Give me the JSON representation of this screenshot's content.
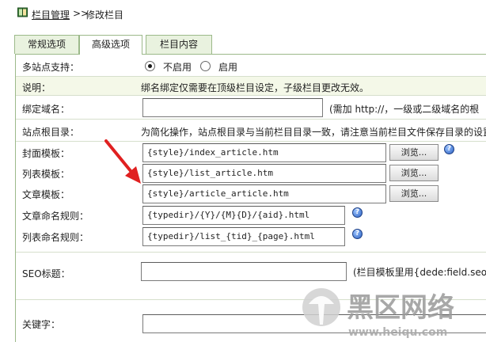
{
  "breadcrumb": {
    "parent": "栏目管理",
    "separator": ">>",
    "current": "修改栏目"
  },
  "tabs": [
    {
      "label": "常规选项",
      "active": false
    },
    {
      "label": "高级选项",
      "active": true
    },
    {
      "label": "栏目内容",
      "active": false
    }
  ],
  "form": {
    "multisite": {
      "label": "多站点支持：",
      "options": [
        {
          "label": "不启用",
          "checked": true
        },
        {
          "label": "启用",
          "checked": false
        }
      ]
    },
    "explain": {
      "label": "说明：",
      "text": "绑名绑定仅需要在顶级栏目设定，子级栏目更改无效。"
    },
    "domain": {
      "label": "绑定域名：",
      "value": "",
      "note": "(需加 http://，一级或二级域名的根"
    },
    "siteroot": {
      "label": "站点根目录：",
      "text": "为简化操作，站点根目录与当前栏目目录一致，请注意当前栏目文件保存目录的设置"
    },
    "cover_tpl": {
      "label": "封面模板：",
      "value": "{style}/index_article.htm",
      "button": "浏览..."
    },
    "list_tpl": {
      "label": "列表模板：",
      "value": "{style}/list_article.htm",
      "button": "浏览..."
    },
    "article_tpl": {
      "label": "文章模板：",
      "value": "{style}/article_article.htm",
      "button": "浏览..."
    },
    "article_rule": {
      "label": "文章命名规则：",
      "value": "{typedir}/{Y}/{M}{D}/{aid}.html"
    },
    "list_rule": {
      "label": "列表命名规则：",
      "value": "{typedir}/list_{tid}_{page}.html"
    },
    "seo_title": {
      "label": "SEO标题：",
      "value": "",
      "note": "(栏目模板里用{dede:field.seot"
    },
    "keywords": {
      "label": "关键字：",
      "value": ""
    }
  },
  "watermark": {
    "text": "黑区网络",
    "url": "www.heiqu.com"
  },
  "colors": {
    "tab_border": "#9cb98a",
    "tab_bg": "#e9f2df",
    "explain_bg": "#f4f8e8",
    "arrow": "#e02020"
  }
}
